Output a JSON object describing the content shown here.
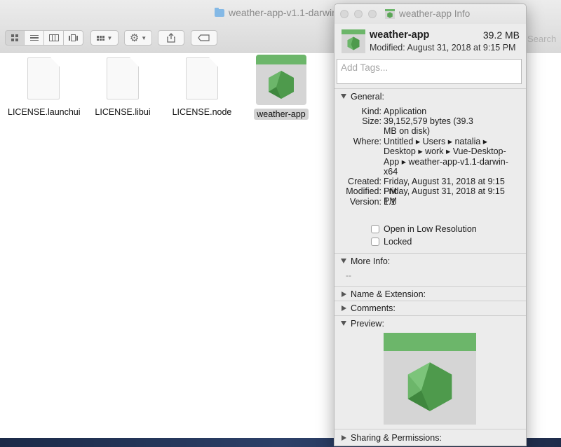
{
  "finder": {
    "title": "weather-app-v1.1-darwin",
    "search_placeholder": "Search",
    "files": [
      {
        "label": "LICENSE.launchui",
        "kind": "document"
      },
      {
        "label": "LICENSE.libui",
        "kind": "document"
      },
      {
        "label": "LICENSE.node",
        "kind": "document"
      },
      {
        "label": "weather-app",
        "kind": "app",
        "selected": true
      }
    ]
  },
  "info": {
    "title": "weather-app Info",
    "name": "weather-app",
    "size": "39.2 MB",
    "modified_line": "Modified: August 31, 2018 at 9:15 PM",
    "tags_placeholder": "Add Tags...",
    "general": {
      "heading": "General:",
      "kind_label": "Kind:",
      "kind": "Application",
      "size_label": "Size:",
      "size": "39,152,579 bytes (39.3 MB on disk)",
      "where_label": "Where:",
      "where": "Untitled ▸ Users ▸ natalia ▸ Desktop ▸ work ▸ Vue-Desktop-App ▸ weather-app-v1.1-darwin-x64",
      "created_label": "Created:",
      "created": "Friday, August 31, 2018 at 9:15 PM",
      "modified_label": "Modified:",
      "modified": "Friday, August 31, 2018 at 9:15 PM",
      "version_label": "Version:",
      "version": "1.1",
      "low_res_label": "Open in Low Resolution",
      "locked_label": "Locked"
    },
    "more_info": {
      "heading": "More Info:",
      "value": "--"
    },
    "name_ext": {
      "heading": "Name & Extension:"
    },
    "comments": {
      "heading": "Comments:"
    },
    "preview": {
      "heading": "Preview:"
    },
    "sharing": {
      "heading": "Sharing & Permissions:"
    }
  },
  "colors": {
    "app_green": "#6cb66a",
    "hex_green": "#5aa556"
  }
}
